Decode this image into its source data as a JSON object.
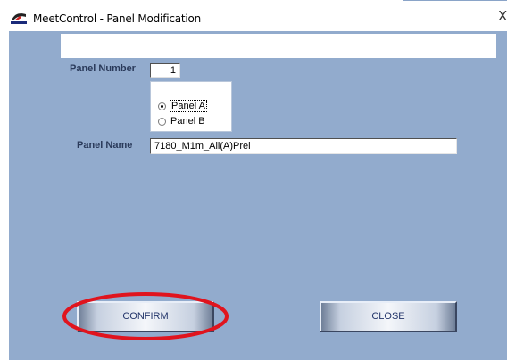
{
  "window": {
    "title": "MeetControl - Panel Modification",
    "close_glyph": "X",
    "icon": "app-icon"
  },
  "form": {
    "panel_number_label": "Panel Number",
    "panel_number_value": "1",
    "radio_options": [
      {
        "label": "Panel A",
        "selected": true
      },
      {
        "label": "Panel B",
        "selected": false
      }
    ],
    "panel_name_label": "Panel Name",
    "panel_name_value": "7180_M1m_All(A)Prel"
  },
  "buttons": {
    "confirm_label": "CONFIRM",
    "close_label": "CLOSE"
  },
  "annotation": {
    "highlight_color": "#e0141e",
    "highlight_target": "confirm-button"
  },
  "colors": {
    "client_bg": "#92abcd",
    "label_text": "#2a3a5a",
    "button_text": "#23356a"
  }
}
